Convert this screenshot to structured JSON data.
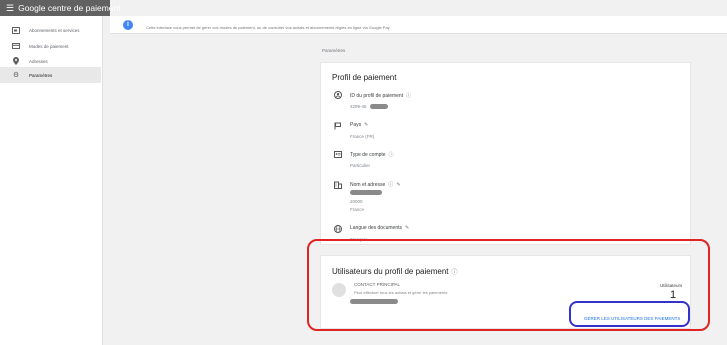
{
  "app": {
    "title": "Google centre de paiement",
    "menu_icon": "menu-icon"
  },
  "sidebar": {
    "items": [
      {
        "label": "Abonnements et services",
        "icon": "subscriptions-icon"
      },
      {
        "label": "Modes de paiement",
        "icon": "credit-card-icon"
      },
      {
        "label": "Adresses",
        "icon": "location-pin-icon"
      },
      {
        "label": "Paramètres",
        "icon": "settings-gear-icon",
        "active": true
      }
    ]
  },
  "banner": {
    "icon": "info-icon",
    "text": "Cette interface vous permet de gérer vos modes de paiement, ou de consulter vos achats et abonnements réglés en ligne via Google Pay"
  },
  "breadcrumb": "Paramètres",
  "profile_card": {
    "title": "Profil de paiement",
    "fields": [
      {
        "icon": "account-icon",
        "label": "ID du profil de paiement",
        "value": "4299-46",
        "has_info": true,
        "has_edit": false
      },
      {
        "icon": "flag-icon",
        "label": "Pays",
        "value": "France (FR)",
        "has_info": false,
        "has_edit": true
      },
      {
        "icon": "id-card-icon",
        "label": "Type de compte",
        "value": "Particulier",
        "has_info": true,
        "has_edit": false
      },
      {
        "icon": "building-icon",
        "label": "Nom et adresse",
        "value_line2": "20000",
        "value_line3": "France",
        "has_info": true,
        "has_edit": true
      },
      {
        "icon": "globe-icon",
        "label": "Langue des documents",
        "value": "Français",
        "has_info": false,
        "has_edit": true
      }
    ]
  },
  "users_card": {
    "title": "Utilisateurs du profil de paiement",
    "user_name": "Contact principal",
    "user_desc": "Peut effectuer tous les achats et gérer les paiements",
    "users_label": "Utilisateurs",
    "users_count": "1",
    "manage_button": "GÉRER LES UTILISATEURS DES PAIEMENTS"
  },
  "colors": {
    "appbar": "#616161",
    "link": "#1a73e8",
    "info": "#4285f4",
    "annotation_red": "#e02424",
    "annotation_blue": "#3333cc"
  }
}
